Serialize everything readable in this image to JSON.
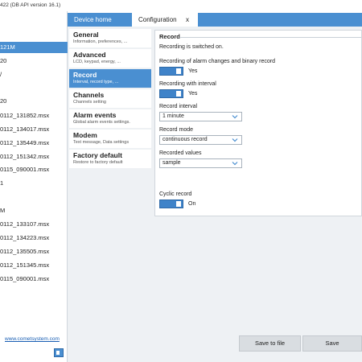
{
  "window": {
    "title": "422 (DB API version 16.1)"
  },
  "tree": {
    "items": [
      {
        "label": "121M",
        "selected": true
      },
      {
        "label": "20",
        "selected": false
      },
      {
        "label": "/",
        "selected": false
      },
      {
        "label": "",
        "selected": false
      },
      {
        "label": "20",
        "selected": false
      },
      {
        "label": "0112_131852.msx",
        "selected": false
      },
      {
        "label": "0112_134017.msx",
        "selected": false
      },
      {
        "label": "0112_135449.msx",
        "selected": false
      },
      {
        "label": "0112_151342.msx",
        "selected": false
      },
      {
        "label": "0115_090001.msx",
        "selected": false
      },
      {
        "label": "1",
        "selected": false
      },
      {
        "label": "",
        "selected": false
      },
      {
        "label": "M",
        "selected": false
      },
      {
        "label": "0112_133107.msx",
        "selected": false
      },
      {
        "label": "0112_134223.msx",
        "selected": false
      },
      {
        "label": "0112_135505.msx",
        "selected": false
      },
      {
        "label": "0112_151345.msx",
        "selected": false
      },
      {
        "label": "0115_090001.msx",
        "selected": false
      }
    ],
    "link": "www.cometsystem.com"
  },
  "tabs": {
    "device_home": "Device home",
    "configuration": "Configuration",
    "close": "x"
  },
  "nav": [
    {
      "title": "General",
      "subtitle": "Information, preferences, ...",
      "active": false
    },
    {
      "title": "Advanced",
      "subtitle": "LCD, keypad, energy, ...",
      "active": false
    },
    {
      "title": "Record",
      "subtitle": "Interval, record type, ...",
      "active": true
    },
    {
      "title": "Channels",
      "subtitle": "Channels setting",
      "active": false
    },
    {
      "title": "Alarm events",
      "subtitle": "Global alarm events settings.",
      "active": false
    },
    {
      "title": "Modem",
      "subtitle": "Text message, Data settings",
      "active": false
    },
    {
      "title": "Factory default",
      "subtitle": "Restore to factory default",
      "active": false
    }
  ],
  "record": {
    "header": "Record",
    "status": "Recording is switched on.",
    "alarm_label": "Recording of alarm changes and binary record",
    "alarm_value": "Yes",
    "interval_toggle_label": "Recording with interval",
    "interval_toggle_value": "Yes",
    "interval_label": "Record interval",
    "interval_value": "1 minute",
    "mode_label": "Record mode",
    "mode_value": "continuous record",
    "values_label": "Recorded values",
    "values_value": "sample",
    "cyclic_label": "Cyclic record",
    "cyclic_value": "On"
  },
  "buttons": {
    "save_to_file": "Save to file",
    "save": "Save"
  },
  "colors": {
    "accent": "#4a8fd1",
    "toggle": "#3f83c9",
    "content_bg": "#eef1f4",
    "button_bg": "#d9dde1"
  },
  "icons": {
    "chevron": "chevron-down-icon",
    "panel_toggle": "panel-toggle-icon"
  }
}
